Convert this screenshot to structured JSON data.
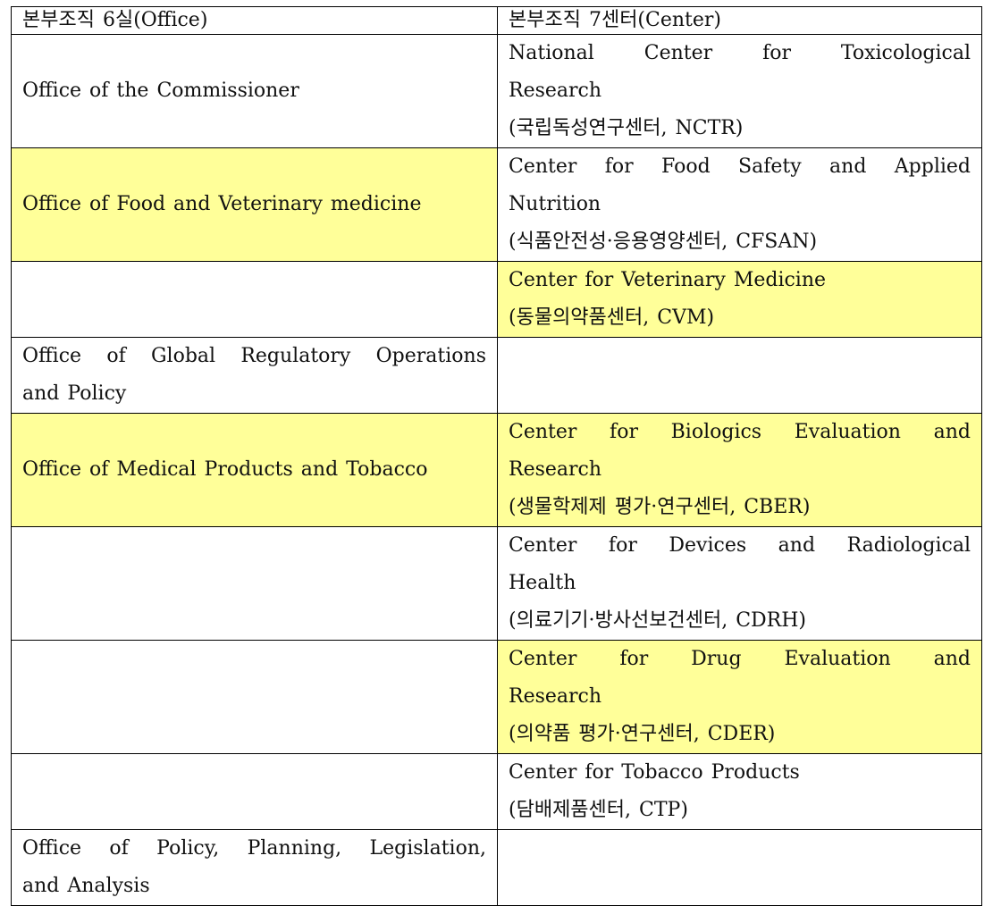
{
  "table": {
    "headers": {
      "office": "본부조직 6실(Office)",
      "center": "본부조직 7센터(Center)"
    },
    "highlight_color": "#FFFF99",
    "rows": [
      {
        "office": "Office of the Commissioner",
        "office_highlight": false,
        "center_line1": "National Center for Toxicological",
        "center_line2": "Research",
        "center_korean": "(국립독성연구센터, NCTR)",
        "center_highlight": false
      },
      {
        "office": "Office of Food and Veterinary medicine",
        "office_highlight": true,
        "center_line1": "Center for Food Safety and Applied",
        "center_line2": "Nutrition",
        "center_korean": "(식품안전성·응용영양센터, CFSAN)",
        "center_highlight": false
      },
      {
        "office": "",
        "office_highlight": false,
        "center_line1": "Center for Veterinary Medicine",
        "center_korean": "(동물의약품센터, CVM)",
        "center_highlight": true
      },
      {
        "office_line1": "Office of Global Regulatory Operations",
        "office_line2": "and Policy",
        "office_highlight": false,
        "center_line1": "",
        "center_highlight": false
      },
      {
        "office": "Office of Medical Products and Tobacco",
        "office_highlight": true,
        "center_line1": "Center for Biologics Evaluation and",
        "center_line2": "Research",
        "center_korean": "(생물학제제 평가·연구센터, CBER)",
        "center_highlight": true
      },
      {
        "office": "",
        "office_highlight": false,
        "center_line1": "Center for Devices and Radiological",
        "center_line2": "Health",
        "center_korean": "(의료기기·방사선보건센터, CDRH)",
        "center_highlight": false
      },
      {
        "office": "",
        "office_highlight": false,
        "center_line1": "Center for Drug Evaluation and",
        "center_line2": "Research",
        "center_korean": "(의약품 평가·연구센터, CDER)",
        "center_highlight": true
      },
      {
        "office": "",
        "office_highlight": false,
        "center_line1": "Center for Tobacco Products",
        "center_korean": "(담배제품센터, CTP)",
        "center_highlight": false
      },
      {
        "office_line1": "Office of Policy, Planning, Legislation,",
        "office_line2": "and Analysis",
        "office_highlight": false,
        "center_line1": "",
        "center_highlight": false
      }
    ]
  }
}
